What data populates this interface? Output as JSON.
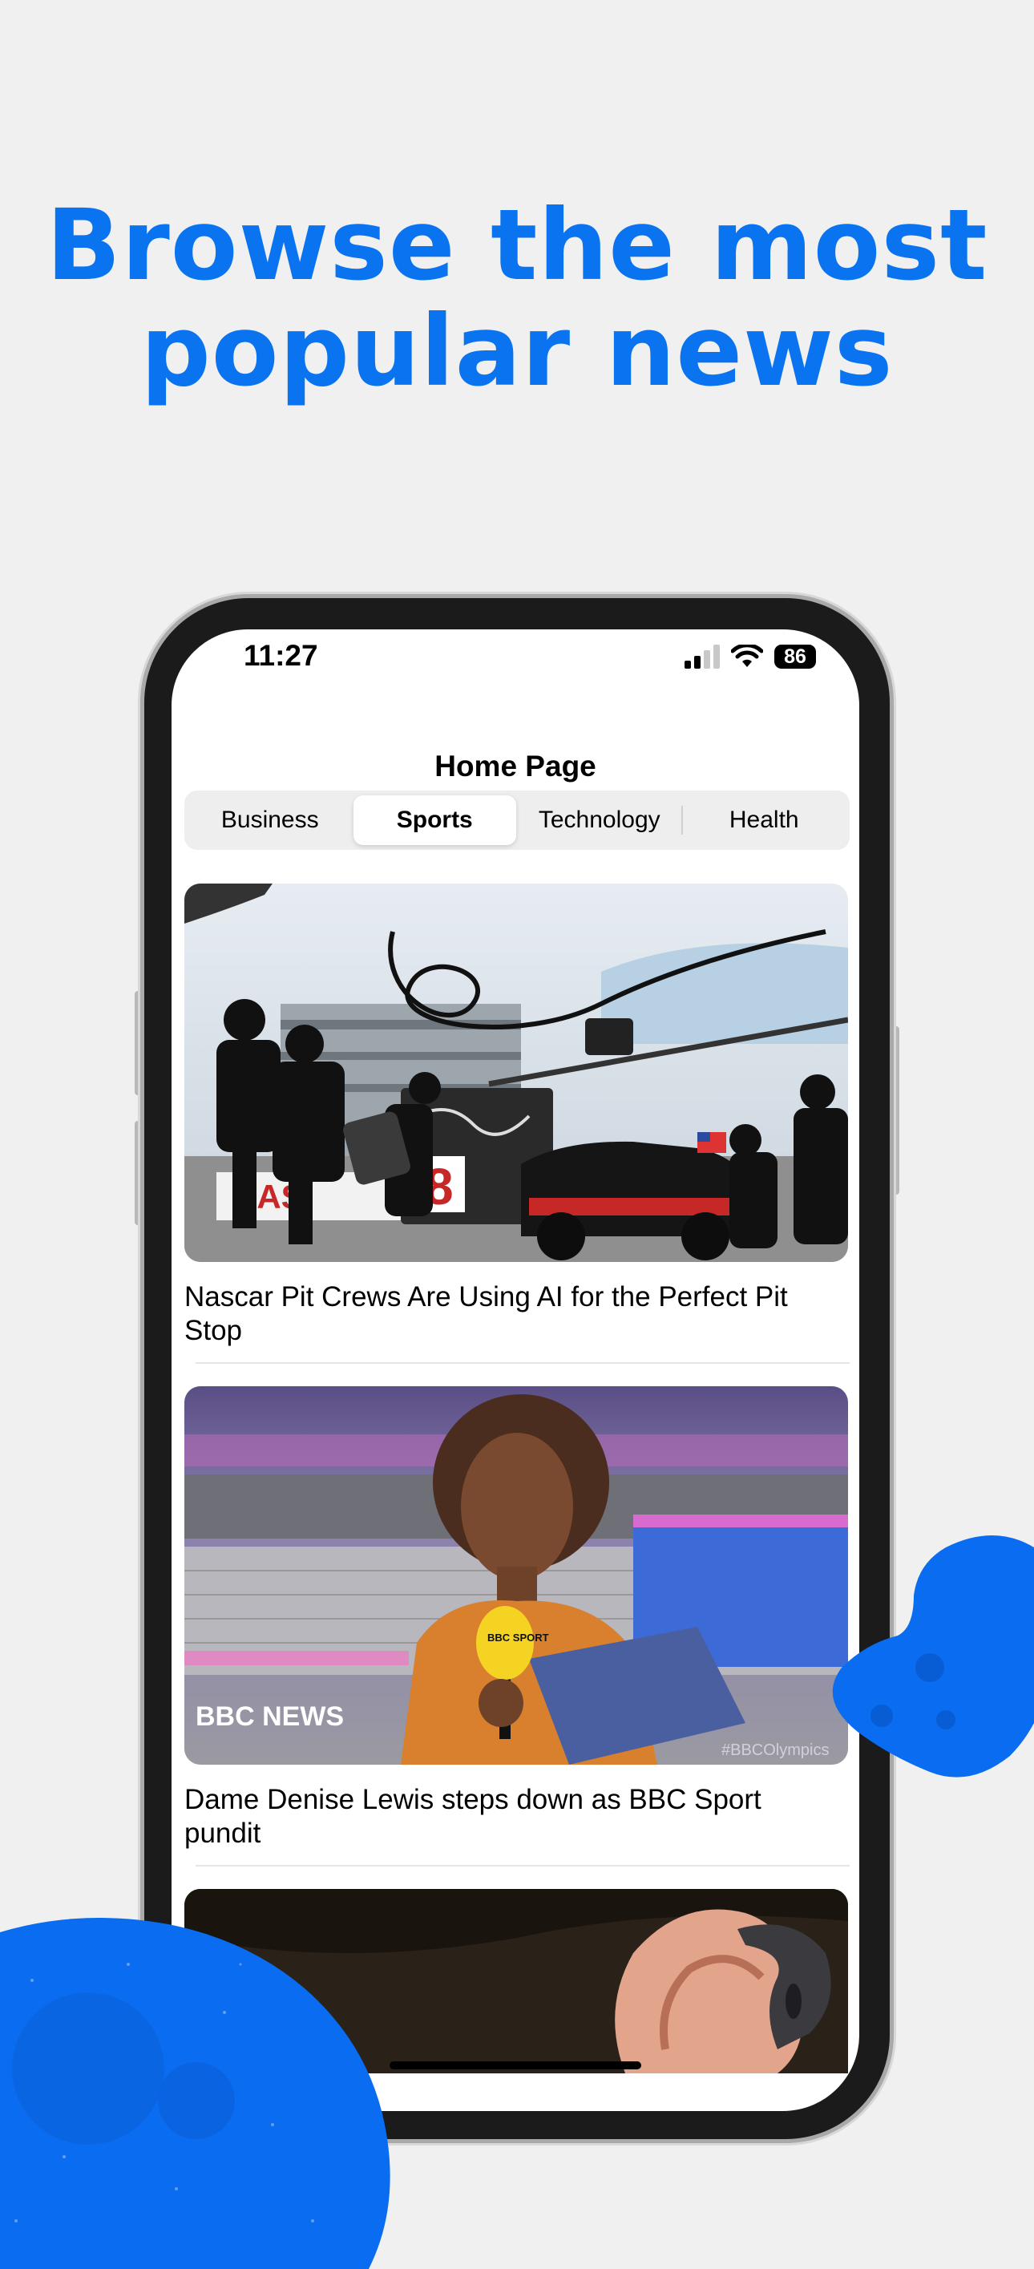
{
  "headline": {
    "line1": "Browse the most",
    "line2": "popular news"
  },
  "status_bar": {
    "time": "11:27",
    "battery": "86",
    "icons": [
      "cellular-signal-icon",
      "wifi-icon",
      "battery-icon"
    ]
  },
  "nav": {
    "title": "Home Page"
  },
  "tabs": [
    {
      "label": "Business",
      "selected": false
    },
    {
      "label": "Sports",
      "selected": true
    },
    {
      "label": "Technology",
      "selected": false
    },
    {
      "label": "Health",
      "selected": false
    }
  ],
  "articles": [
    {
      "title": "Nascar Pit Crews Are Using AI for the Perfect Pit Stop",
      "image_overlay_text": "8"
    },
    {
      "title": "Dame Denise Lewis steps down as BBC Sport pundit",
      "image_overlay_text": "BBC NEWS",
      "image_caption": "#BBCOlympics",
      "image_mic_text": "BBC SPORT"
    },
    {
      "title": ""
    }
  ],
  "colors": {
    "accent": "#0a74f0",
    "background": "#f0f0f0",
    "blob": "#0a6cf0"
  }
}
